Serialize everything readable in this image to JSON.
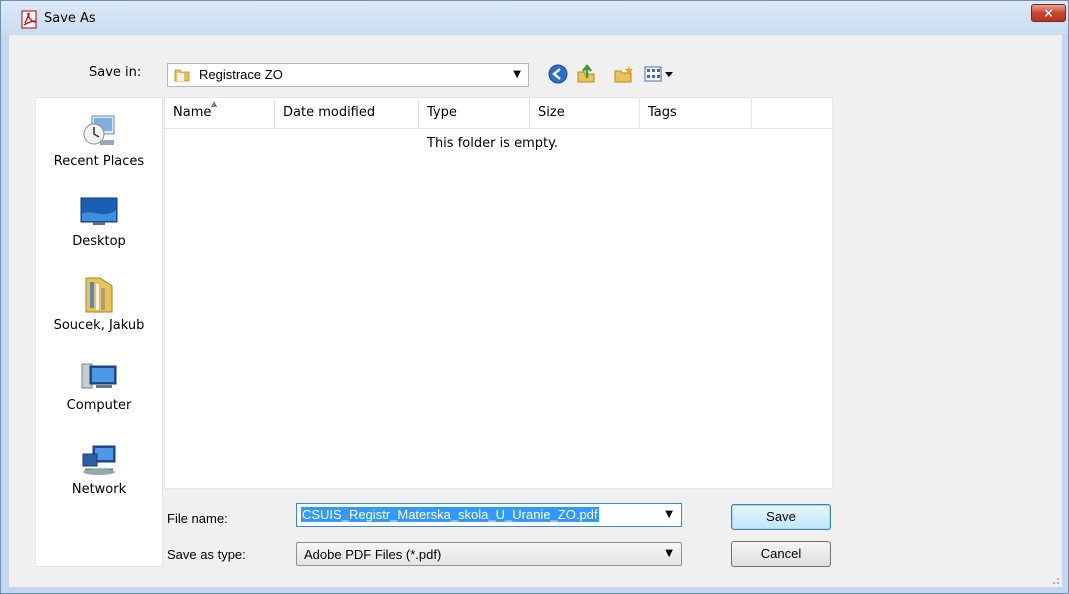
{
  "window": {
    "title": "Save As",
    "close_symbol": "×",
    "title_icon": "pdf-document-icon"
  },
  "toolbar": {
    "save_in_label": "Save in:",
    "location": "Registrace ZO",
    "icons": [
      "back-icon",
      "up-folder-icon",
      "new-folder-icon",
      "view-menu-icon"
    ]
  },
  "places": [
    {
      "id": "recent-places",
      "label": "Recent Places",
      "icon": "recent-places-icon"
    },
    {
      "id": "desktop",
      "label": "Desktop",
      "icon": "desktop-icon"
    },
    {
      "id": "user",
      "label": "Soucek, Jakub",
      "icon": "user-folder-icon"
    },
    {
      "id": "computer",
      "label": "Computer",
      "icon": "computer-icon"
    },
    {
      "id": "network",
      "label": "Network",
      "icon": "network-icon"
    }
  ],
  "file_list": {
    "columns": [
      "Name",
      "Date modified",
      "Type",
      "Size",
      "Tags"
    ],
    "empty_message": "This folder is empty."
  },
  "form": {
    "file_name_label": "File name:",
    "file_name_value": "CSUIS_Registr_Materska_skola_U_Uranie_ZO.pdf",
    "save_as_type_label": "Save as type:",
    "save_as_type_value": "Adobe PDF Files (*.pdf)"
  },
  "buttons": {
    "save": "Save",
    "cancel": "Cancel"
  }
}
